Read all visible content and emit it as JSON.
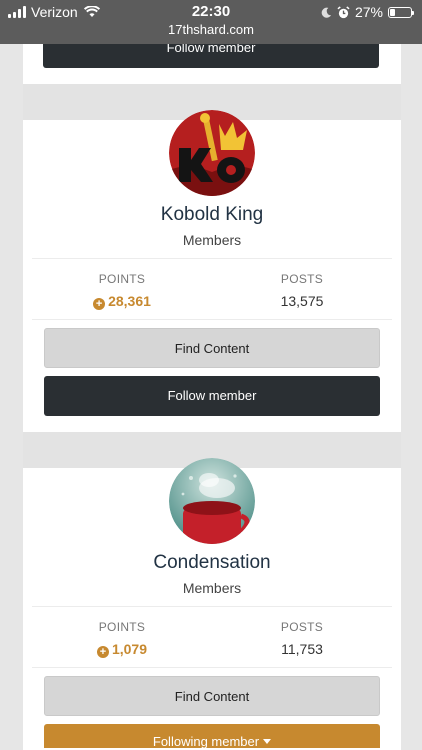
{
  "status_bar": {
    "carrier": "Verizon",
    "time": "22:30",
    "url": "17thshard.com",
    "battery_percent": "27%",
    "battery_level": 0.27,
    "icons": [
      "signal-icon",
      "wifi-icon",
      "moon-icon",
      "alarm-icon",
      "battery-icon"
    ]
  },
  "top_card": {
    "follow_label": "Follow member"
  },
  "members": [
    {
      "name": "Kobold King",
      "group": "Members",
      "points_label": "POINTS",
      "points": "28,361",
      "posts_label": "POSTS",
      "posts": "13,575",
      "find_label": "Find Content",
      "follow_label": "Follow member"
    },
    {
      "name": "Condensation",
      "group": "Members",
      "points_label": "POINTS",
      "points": "1,079",
      "posts_label": "POSTS",
      "posts": "11,753",
      "find_label": "Find Content",
      "follow_label": "Following member"
    }
  ],
  "colors": {
    "accent": "#c7892f",
    "dark_button": "#2a2f33",
    "status_bar": "#5c5c5c"
  }
}
